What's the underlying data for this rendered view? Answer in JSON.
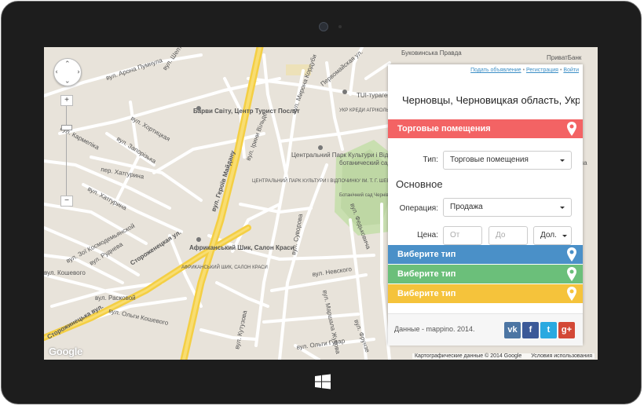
{
  "map": {
    "streets": [
      "вул. Арона Пумнула",
      "вул. Шептицкого",
      "вул. Хортицкая",
      "вул. Запорізька",
      "пер. Хатгурина",
      "вул. Хатгурина",
      "вул. Кармеліка",
      "вул. Зої Космодемьянской",
      "вул. Руднева",
      "вул. Кошевого",
      "вул. Расковой",
      "вул. Ольги Кошевого",
      "Стороженецкая ул.",
      "Сторожинецька вул.",
      "вул. Героїв Майдану",
      "вул. Ірини Вільде",
      "вул. Мирона Кордуби",
      "вул. Суворова",
      "вул. Невского",
      "вул. Маршала Жукова",
      "вул. Кутузова",
      "вул. Ольги Гузар",
      "вул. Федьковича",
      "Первомайская ул.",
      "вул. Фрунзе"
    ],
    "places": [
      "Барви Світу, Центр Турист Послуг",
      "Центральний Парк Культури і Відпочинку ім. Т. Г. Шевченка",
      "ЦЕНТРАЛЬНИЙ ПАРК КУЛЬТУРИ І ВІДПОЧИНКУ ІМ. Т. Г. ШЕВЧЕНКА",
      "Африканський Шик, Салон Краси",
      "АФРИКАНСЬКИЙ ШИК, САЛОН КРАСИ",
      "ботанический сад Черновицкого национального университета им. Юрия Федьковича",
      "Ботанічний сад Чернівецького національного університету імені Юрія Федьковича",
      "TUI-турагентство",
      "УКР КРЕДИ АГРІКОЛЬ БАНК",
      "Буковинська Правда",
      "ПриватБанк"
    ],
    "google_logo": "Google",
    "copyright": "Картографические данные © 2014 Google",
    "terms": "Условия использования",
    "zoom_in": "+",
    "zoom_out": "−"
  },
  "panel": {
    "links": [
      "Подать объявление",
      "Регистрация",
      "Войти"
    ],
    "location": "Черновцы, Черновицкая область, Украина",
    "category_active": {
      "label": "Торговые помещения",
      "color": "#f36364"
    },
    "type_label": "Тип:",
    "type_value": "Торговые помещения",
    "section_title": "Основное",
    "operation_label": "Операция:",
    "operation_value": "Продажа",
    "price_label": "Цена:",
    "price_from_placeholder": "От",
    "price_to_placeholder": "До",
    "currency_value": "Дол.",
    "choose_bars": [
      {
        "label": "Виберите тип",
        "color": "#4a90c8"
      },
      {
        "label": "Виберите тип",
        "color": "#6bbf7a"
      },
      {
        "label": "Виберите тип",
        "color": "#f5c33b"
      }
    ],
    "footer_text": "Данные - mappino. 2014.",
    "social": [
      {
        "name": "vk",
        "glyph": "vk",
        "color": "#4c75a3"
      },
      {
        "name": "facebook",
        "glyph": "f",
        "color": "#3b5998"
      },
      {
        "name": "twitter",
        "glyph": "t",
        "color": "#2aa9e0"
      },
      {
        "name": "google-plus",
        "glyph": "g+",
        "color": "#d34836"
      }
    ]
  }
}
